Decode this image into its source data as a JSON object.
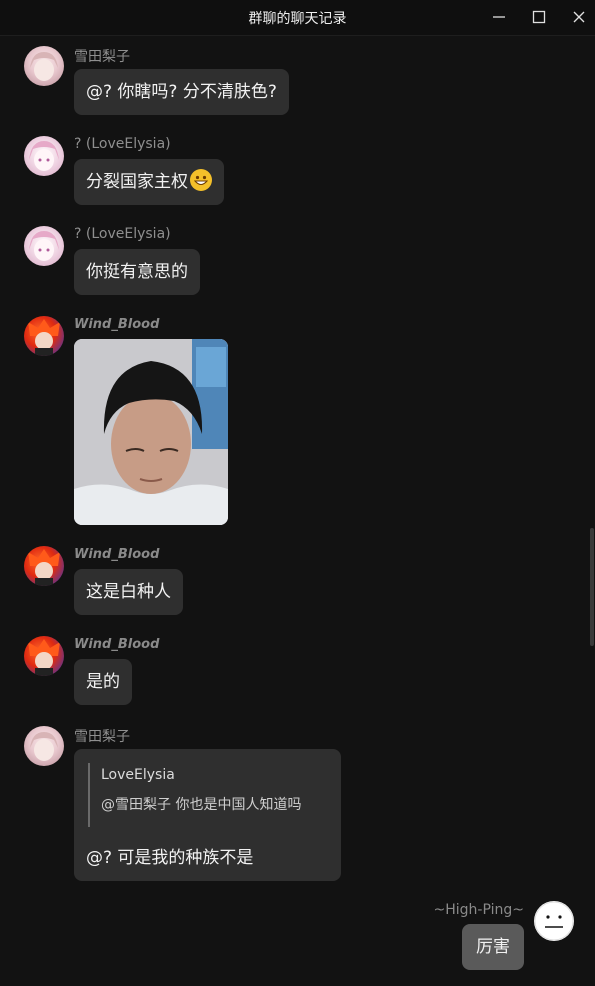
{
  "window": {
    "title": "群聊的聊天记录",
    "minimize_icon": "minimize-icon",
    "maximize_icon": "maximize-icon",
    "close_icon": "close-icon"
  },
  "messages": [
    {
      "sender": "雪田梨子",
      "text": "@? 你瞎吗? 分不清肤色?"
    },
    {
      "sender": "? (LoveElysia)",
      "text": "分裂国家主权",
      "emoji": "grinning-emoji"
    },
    {
      "sender": "? (LoveElysia)",
      "text": "你挺有意思的"
    },
    {
      "sender": "Wind_Blood",
      "image": "photo-of-boy"
    },
    {
      "sender": "Wind_Blood",
      "text": "这是白种人"
    },
    {
      "sender": "Wind_Blood",
      "text": "是的"
    },
    {
      "sender": "雪田梨子",
      "quote": {
        "name": "LoveElysia",
        "text": "@雪田梨子 你也是中国人知道吗"
      },
      "text": "@? 可是我的种族不是"
    }
  ],
  "self": {
    "name": "~High-Ping~",
    "text": "厉害"
  }
}
